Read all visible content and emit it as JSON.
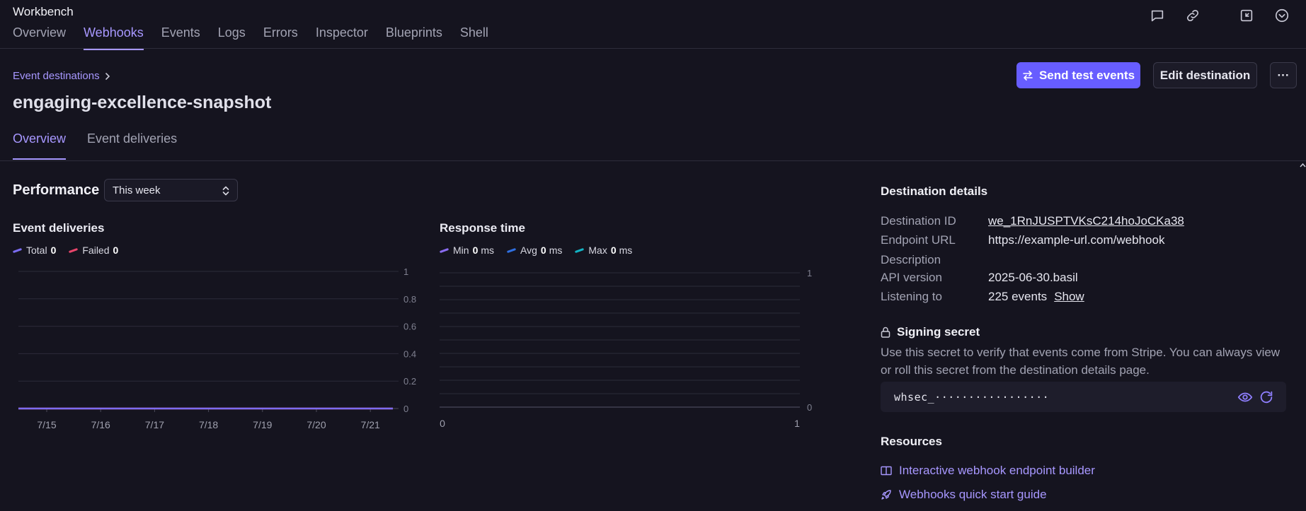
{
  "app": {
    "title": "Workbench"
  },
  "nav": {
    "items": [
      {
        "label": "Overview",
        "active": false
      },
      {
        "label": "Webhooks",
        "active": true
      },
      {
        "label": "Events",
        "active": false
      },
      {
        "label": "Logs",
        "active": false
      },
      {
        "label": "Errors",
        "active": false
      },
      {
        "label": "Inspector",
        "active": false
      },
      {
        "label": "Blueprints",
        "active": false
      },
      {
        "label": "Shell",
        "active": false
      }
    ]
  },
  "top_icons": [
    "chat-icon",
    "link-icon",
    "collapse-icon",
    "chevron-circle-icon"
  ],
  "header": {
    "breadcrumb": "Event destinations",
    "title": "engaging-excellence-snapshot",
    "send_test_label": "Send test events",
    "edit_label": "Edit destination",
    "more_label": "···"
  },
  "tabs": [
    {
      "label": "Overview",
      "active": true
    },
    {
      "label": "Event deliveries",
      "active": false
    }
  ],
  "performance": {
    "title": "Performance",
    "period": "This week"
  },
  "colors": {
    "accent": "#a797ff",
    "primary_button": "#675dff",
    "total": "#7b6cf0",
    "failed": "#e8456b",
    "min": "#8a6cf0",
    "avg": "#2f6fe0",
    "max": "#12b3c4"
  },
  "chart_data": [
    {
      "type": "line",
      "title": "Event deliveries",
      "categories": [
        "7/15",
        "7/16",
        "7/17",
        "7/18",
        "7/19",
        "7/20",
        "7/21"
      ],
      "series": [
        {
          "name": "Total",
          "total": "0",
          "values": [
            0,
            0,
            0,
            0,
            0,
            0,
            0
          ]
        },
        {
          "name": "Failed",
          "total": "0",
          "values": [
            0,
            0,
            0,
            0,
            0,
            0,
            0
          ]
        }
      ],
      "yticks": [
        "0",
        "0.2",
        "0.4",
        "0.6",
        "0.8",
        "1"
      ],
      "ylim": [
        0,
        1
      ]
    },
    {
      "type": "line",
      "title": "Response time",
      "series": [
        {
          "name": "Min",
          "total": "0",
          "unit": "ms",
          "values": []
        },
        {
          "name": "Avg",
          "total": "0",
          "unit": "ms",
          "values": []
        },
        {
          "name": "Max",
          "total": "0",
          "unit": "ms",
          "values": []
        }
      ],
      "xticks": [
        "0",
        "1"
      ],
      "yticks": [
        "0",
        "1"
      ],
      "xlim": [
        0,
        1
      ],
      "ylim": [
        0,
        1
      ]
    }
  ],
  "details": {
    "title": "Destination details",
    "rows": [
      {
        "label": "Destination ID",
        "value": "we_1RnJUSPTVKsC214hoJoCKa38"
      },
      {
        "label": "Endpoint URL",
        "value": "https://example-url.com/webhook"
      },
      {
        "label": "Description",
        "value": ""
      },
      {
        "label": "API version",
        "value": "2025-06-30.basil"
      },
      {
        "label": "Listening to",
        "value": "225 events",
        "action": "Show"
      }
    ]
  },
  "secret": {
    "title": "Signing secret",
    "description": "Use this secret to verify that events come from Stripe. You can always view or roll this secret from the destination details page.",
    "value": "whsec_·················"
  },
  "resources": {
    "title": "Resources",
    "links": [
      {
        "label": "Interactive webhook endpoint builder",
        "icon": "book-icon"
      },
      {
        "label": "Webhooks quick start guide",
        "icon": "rocket-icon"
      }
    ]
  }
}
